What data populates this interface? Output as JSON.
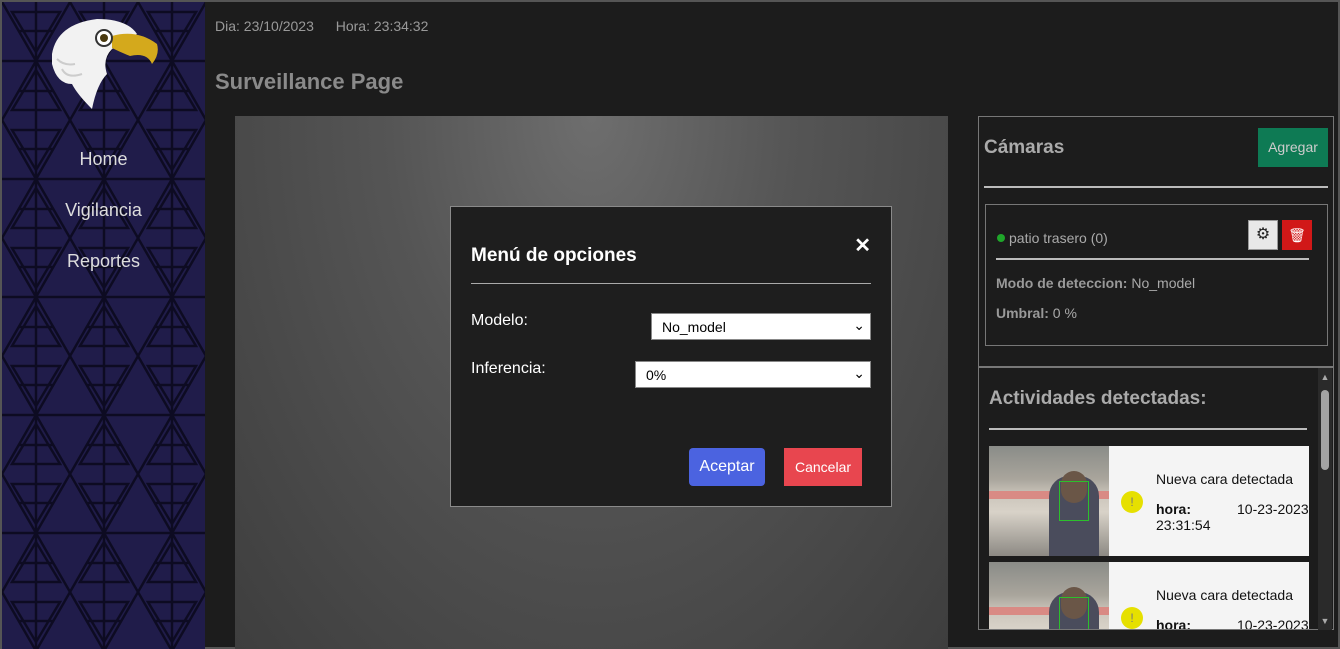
{
  "header": {
    "date": "Dia: 23/10/2023",
    "time": "Hora: 23:34:32",
    "title": "Surveillance Page"
  },
  "sidebar": {
    "logo_icon": "eagle-logo-icon",
    "items": [
      {
        "label": "Home"
      },
      {
        "label": "Vigilancia"
      },
      {
        "label": "Reportes"
      }
    ]
  },
  "modal": {
    "title": "Menú de opciones",
    "close_icon": "close-icon",
    "modelo_label": "Modelo:",
    "modelo_value": "No_model",
    "inferencia_label": "Inferencia:",
    "inferencia_value": "0%",
    "accept_label": "Aceptar",
    "cancel_label": "Cancelar"
  },
  "cameras": {
    "title": "Cámaras",
    "add_label": "Agregar",
    "list": [
      {
        "name": "patio trasero (0)",
        "status_color": "#1fa62a",
        "mode_label": "Modo de deteccion:",
        "mode_value": "No_model",
        "threshold_label": "Umbral:",
        "threshold_value": "0 %"
      }
    ]
  },
  "activities": {
    "title": "Actividades detectadas:",
    "items": [
      {
        "message": "Nueva cara detectada",
        "hora_label": "hora:",
        "date": "10-23-2023",
        "time": "23:31:54"
      },
      {
        "message": "Nueva cara detectada",
        "hora_label": "hora:",
        "date": "10-23-2023",
        "time": ""
      }
    ]
  },
  "colors": {
    "sidebar_bg": "#201c4a",
    "accept": "#4b63e0",
    "cancel": "#e8464f",
    "add": "#0e7a54",
    "delete": "#d11818"
  }
}
